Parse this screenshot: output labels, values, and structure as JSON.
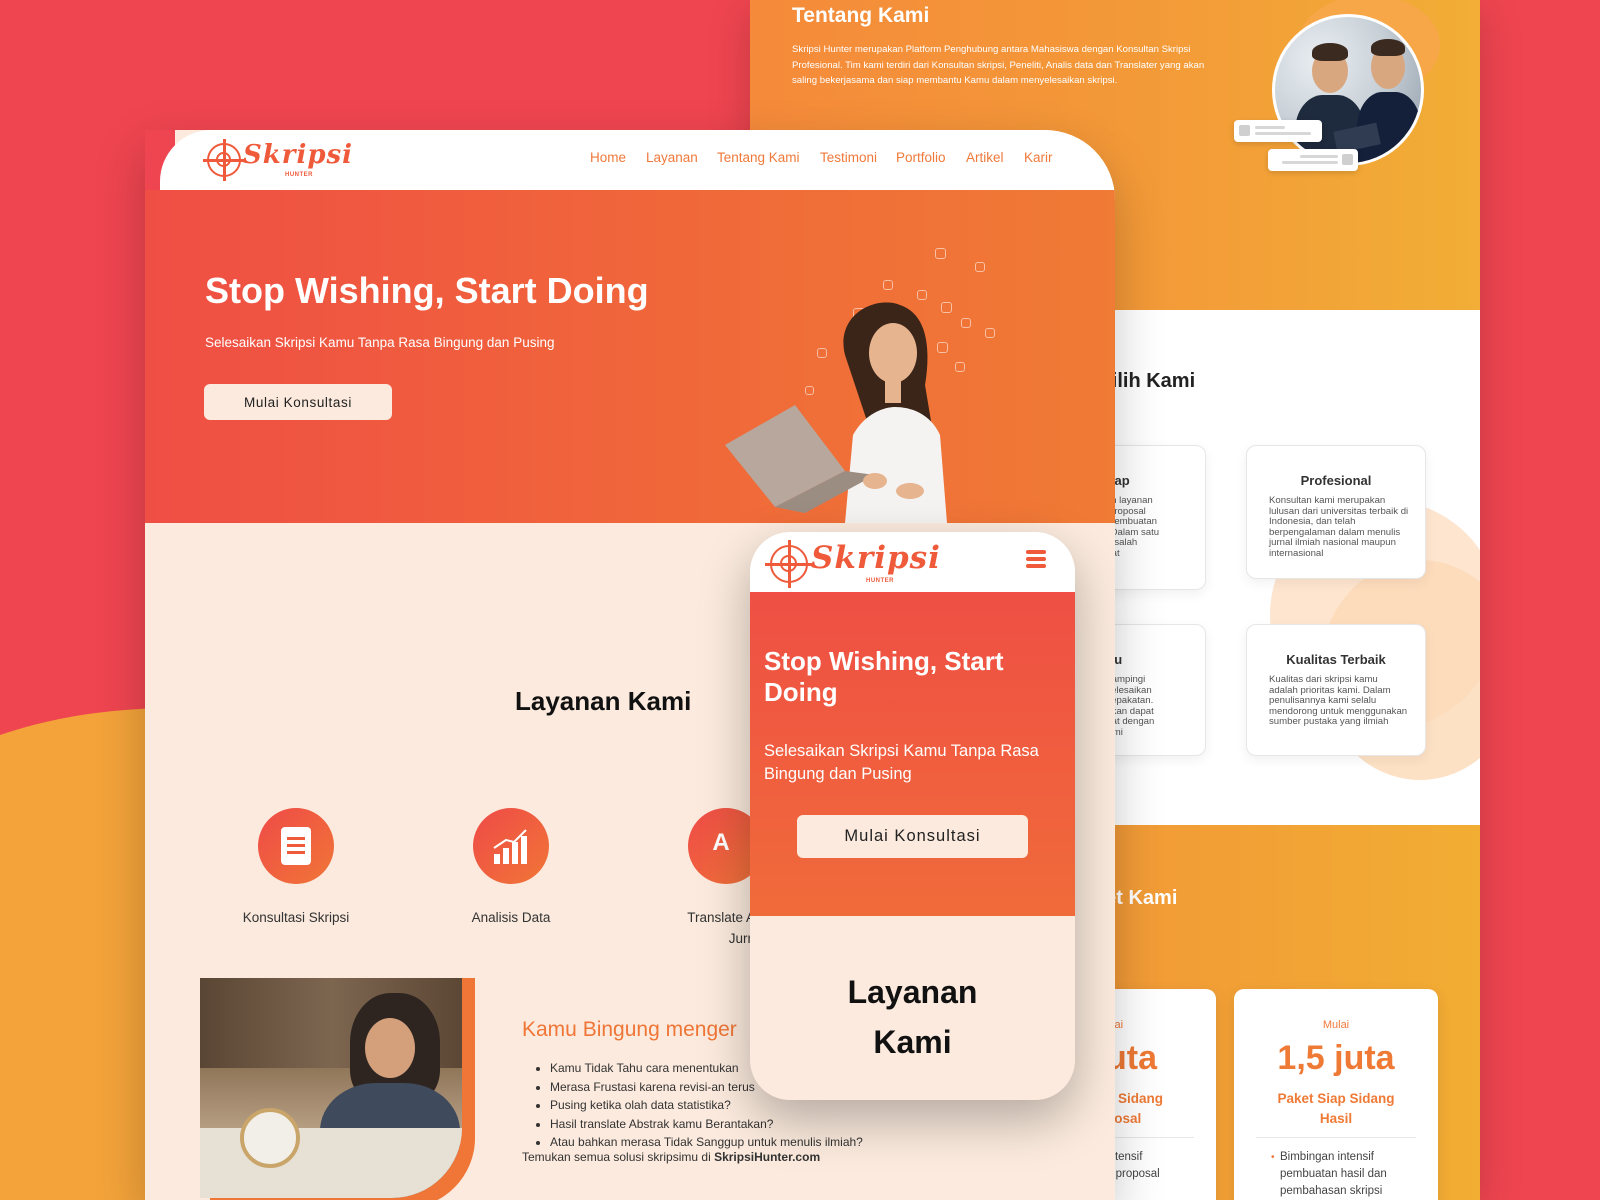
{
  "colors": {
    "background_red": "#ef4550",
    "background_orange": "#f3a33a",
    "accent_orange": "#f07637",
    "hero_gradient_start": "#ef4e44",
    "hero_gradient_end": "#f07b35",
    "cream": "#fbeadd"
  },
  "brand": {
    "logo_text": "Skripsi",
    "logo_sub": "HUNTER"
  },
  "desktop": {
    "nav": {
      "items": [
        "Home",
        "Layanan",
        "Tentang Kami",
        "Testimoni",
        "Portfolio",
        "Artikel",
        "Karir"
      ]
    },
    "hero": {
      "title": "Stop Wishing, Start Doing",
      "subtitle": "Selesaikan Skripsi Kamu Tanpa Rasa Bingung dan Pusing",
      "button": "Mulai Konsultasi"
    },
    "layanan": {
      "title": "Layanan Kami",
      "services": [
        {
          "label": "Konsultasi Skripsi",
          "icon": "document-icon"
        },
        {
          "label": "Analisis Data",
          "icon": "bar-chart-icon"
        },
        {
          "label": "Translate A",
          "label2": "Jurn",
          "icon": "translate-icon"
        }
      ]
    },
    "bingung": {
      "title": "Kamu Bingung menger",
      "items": [
        "Kamu Tidak Tahu cara menentukan",
        "Merasa Frustasi karena revisi-an terus",
        "Pusing ketika olah data statistika?",
        "Hasil translate Abstrak kamu Berantakan?",
        "Atau bahkan merasa Tidak Sanggup untuk menulis ilmiah?"
      ],
      "footer_prefix": "Temukan semua solusi skripsimu di ",
      "footer_site": "SkripsiHunter.com"
    }
  },
  "back_page": {
    "about": {
      "title": "Tentang Kami",
      "body": "Skripsi Hunter merupakan Platform Penghubung antara Mahasiswa dengan Konsultan Skripsi Profesional. Tim kami terdiri dari Konsultan skripsi, Peneliti, Analis data dan Translater yang akan saling bekerjasama dan siap membantu Kamu dalam menyelesaikan skripsi."
    },
    "why": {
      "title": "milih Kami",
      "cards": [
        {
          "title": "Lengkap",
          "body": "kan layanan\nn proposal\nn pembuatan\nil. Dalam satu\nmasalah\napat"
        },
        {
          "title": "Profesional",
          "body": "Konsultan kami merupakan lulusan dari universitas terbaik di Indonesia, dan telah berpengalaman dalam menulis jurnal ilmiah nasional maupun internasional"
        },
        {
          "title": "Waktu",
          "body": "ndampingi\nnyelesaikan\nesepakatan.\nahkan dapat\nepat dengan\nKami"
        },
        {
          "title": "Kualitas Terbaik",
          "body": "Kualitas dari skripsi kamu adalah prioritas kami. Dalam penulisannya kami selalu mendorong untuk menggunakan sumber pustaka yang ilmiah"
        }
      ]
    },
    "paket": {
      "title": "ket Kami",
      "cards": [
        {
          "label": "ulai",
          "value": "uta",
          "name": "p Sidang\nposal",
          "features": [
            "intensif",
            "n proposal"
          ]
        },
        {
          "label": "Mulai",
          "value": "1,5 juta",
          "name": "Paket Siap Sidang\nHasil",
          "features": [
            "Bimbingan intensif",
            "pembuatan hasil dan",
            "pembahasan skripsi"
          ]
        }
      ]
    }
  },
  "mobile": {
    "hero": {
      "title": "Stop Wishing, Start Doing",
      "subtitle": "Selesaikan Skripsi Kamu Tanpa Rasa Bingung dan Pusing",
      "button": "Mulai Konsultasi"
    },
    "layanan_title": "Layanan Kami",
    "menu_icon": "hamburger-menu-icon"
  }
}
